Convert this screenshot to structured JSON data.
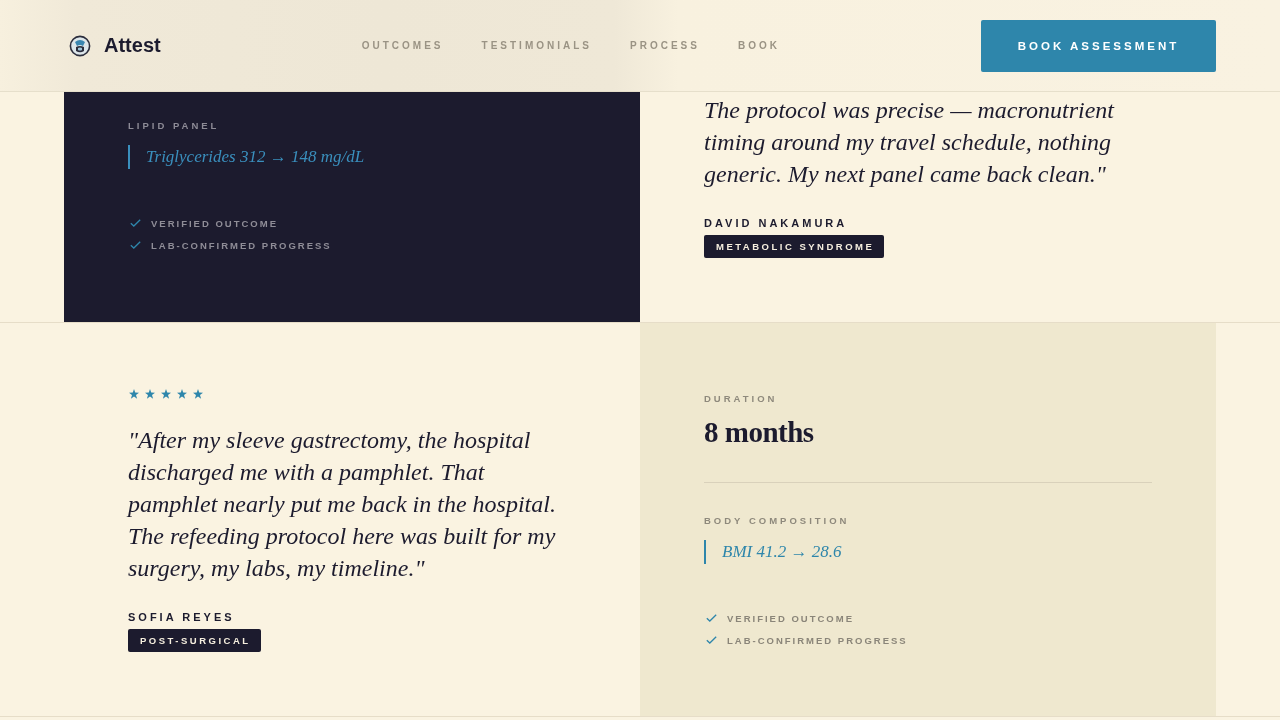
{
  "header": {
    "brand": "Attest",
    "nav": [
      "OUTCOMES",
      "TESTIMONIALS",
      "PROCESS",
      "BOOK"
    ],
    "cta": "BOOK ASSESSMENT"
  },
  "rows": [
    {
      "cells": [
        {
          "kind": "metrics",
          "sections": [
            {
              "kind": "reading",
              "label": "LIPID PANEL",
              "value": "Triglycerides 312 → 148 mg/dL"
            }
          ],
          "checks": [
            "VERIFIED OUTCOME",
            "LAB-CONFIRMED PROGRESS"
          ]
        },
        {
          "kind": "quote",
          "text": "The protocol was precise — macronutrient timing around my travel schedule, nothing generic. My next panel came back clean.\"",
          "name": "DAVID NAKAMURA",
          "tag": "METABOLIC SYNDROME"
        }
      ]
    },
    {
      "cells": [
        {
          "kind": "quote",
          "stars": 5,
          "text": "\"After my sleeve gastrectomy, the hospital discharged me with a pamphlet. That pamphlet nearly put me back in the hospital. The refeeding protocol here was built for my surgery, my labs, my timeline.\"",
          "name": "SOFIA REYES",
          "tag": "POST-SURGICAL"
        },
        {
          "kind": "metrics",
          "sections": [
            {
              "kind": "stat",
              "label": "DURATION",
              "value": "8 months"
            },
            {
              "kind": "reading",
              "label": "BODY COMPOSITION",
              "value": "BMI 41.2 → 28.6"
            }
          ],
          "checks": [
            "VERIFIED OUTCOME",
            "LAB-CONFIRMED PROGRESS"
          ]
        }
      ]
    }
  ]
}
